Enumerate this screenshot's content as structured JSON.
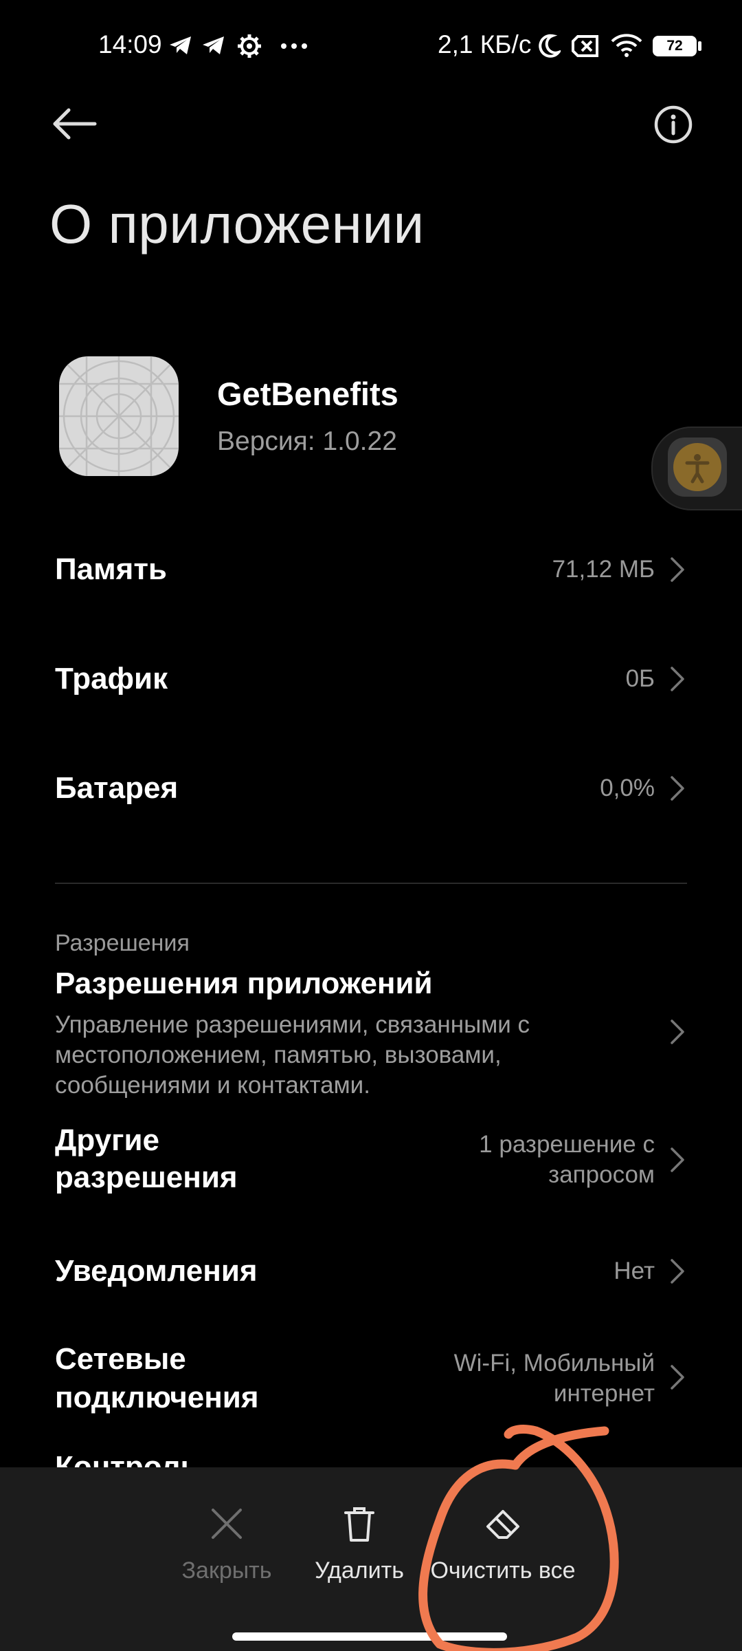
{
  "status_bar": {
    "time": "14:09",
    "speed": "2,1 КБ/с",
    "battery": "72",
    "icons_left": [
      "telegram-icon",
      "telegram-icon",
      "settings-gear-icon",
      "more-dots-icon"
    ],
    "icons_right": [
      "moon-icon",
      "sim-off-icon",
      "wifi-icon",
      "battery-icon"
    ]
  },
  "header": {
    "title": "О приложении"
  },
  "app": {
    "name": "GetBenefits",
    "version": "Версия: 1.0.22"
  },
  "rows": [
    {
      "label": "Память",
      "value": "71,12 МБ"
    },
    {
      "label": "Трафик",
      "value": "0Б"
    },
    {
      "label": "Батарея",
      "value": "0,0%"
    }
  ],
  "permissions": {
    "section": "Разрешения",
    "title": "Разрешения приложений",
    "description": "Управление разрешениями, связанными с местоположением, памятью, вызовами, сообщениями и контактами.",
    "other_label_line1": "Другие",
    "other_label_line2": "разрешения",
    "other_value_line1": "1 разрешение с",
    "other_value_line2": "запросом",
    "notifications_label": "Уведомления",
    "notifications_value": "Нет",
    "network_label_line1": "Сетевые",
    "network_label_line2": "подключения",
    "network_value_line1": "Wi-Fi, Мобильный",
    "network_value_line2": "интернет",
    "partial_next": "Контроль"
  },
  "bottom_bar": {
    "close": "Закрыть",
    "delete": "Удалить",
    "clear_all": "Очистить все"
  },
  "colors": {
    "background": "#000000",
    "bottom_bar": "#1c1c1c",
    "secondary_text": "#9a9a9a",
    "annotation": "#f07a50"
  }
}
